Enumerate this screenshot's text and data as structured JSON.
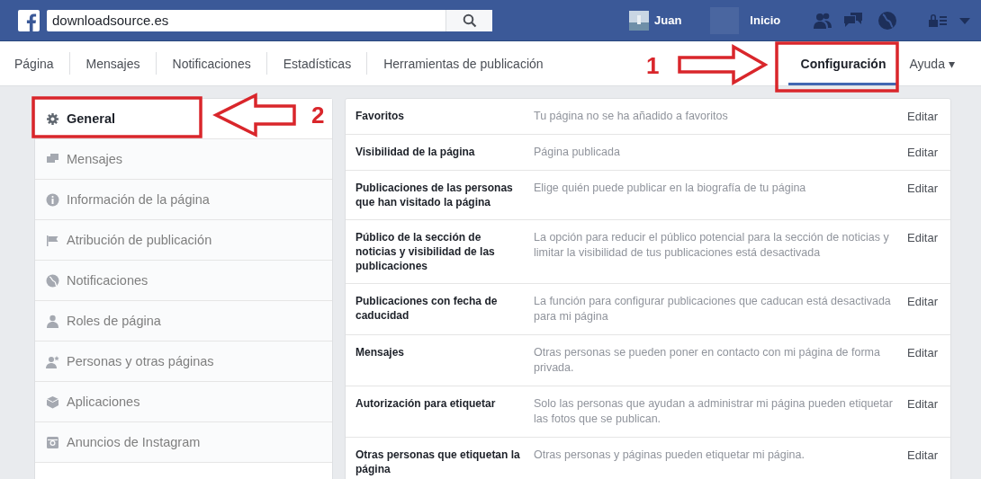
{
  "topbar": {
    "search": {
      "value": "downloadsource.es"
    },
    "user": "Juan",
    "home": "Inicio"
  },
  "nav": {
    "tabs": [
      {
        "label": "Página",
        "selected": false
      },
      {
        "label": "Mensajes",
        "selected": false
      },
      {
        "label": "Notificaciones",
        "selected": false
      },
      {
        "label": "Estadísticas",
        "selected": false
      },
      {
        "label": "Herramientas de publicación",
        "selected": false
      },
      {
        "label": "Configuración",
        "selected": true
      }
    ],
    "help": "Ayuda ▾"
  },
  "sidebar": {
    "items": [
      {
        "label": "General",
        "selected": true
      },
      {
        "label": "Mensajes",
        "selected": false
      },
      {
        "label": "Información de la página",
        "selected": false
      },
      {
        "label": "Atribución de publicación",
        "selected": false
      },
      {
        "label": "Notificaciones",
        "selected": false
      },
      {
        "label": "Roles de página",
        "selected": false
      },
      {
        "label": "Personas y otras páginas",
        "selected": false
      },
      {
        "label": "Aplicaciones",
        "selected": false
      },
      {
        "label": "Anuncios de Instagram",
        "selected": false
      }
    ]
  },
  "settings": {
    "rows": [
      {
        "label": "Favoritos",
        "value": "Tu página no se ha añadido a favoritos",
        "action": "Editar"
      },
      {
        "label": "Visibilidad de la página",
        "value": "Página publicada",
        "action": "Editar"
      },
      {
        "label": "Publicaciones de las personas que han visitado la página",
        "value": "Elige quién puede publicar en la biografía de tu página",
        "action": "Editar"
      },
      {
        "label": "Público de la sección de noticias y visibilidad de las publicaciones",
        "value": "La opción para reducir el público potencial para la sección de noticias y limitar la visibilidad de tus publicaciones está desactivada",
        "action": "Editar"
      },
      {
        "label": "Publicaciones con fecha de caducidad",
        "value": "La función para configurar publicaciones que caducan está desactivada para mi página",
        "action": "Editar"
      },
      {
        "label": "Mensajes",
        "value": "Otras personas se pueden poner en contacto con mi página de forma privada.",
        "action": "Editar"
      },
      {
        "label": "Autorización para etiquetar",
        "value": "Solo las personas que ayudan a administrar mi página pueden etiquetar las fotos que se publican.",
        "action": "Editar"
      },
      {
        "label": "Otras personas que etiquetan la página",
        "value": "Otras personas y páginas pueden etiquetar mi página.",
        "action": "Editar"
      }
    ]
  },
  "callouts": [
    {
      "number": "1"
    },
    {
      "number": "2"
    }
  ]
}
